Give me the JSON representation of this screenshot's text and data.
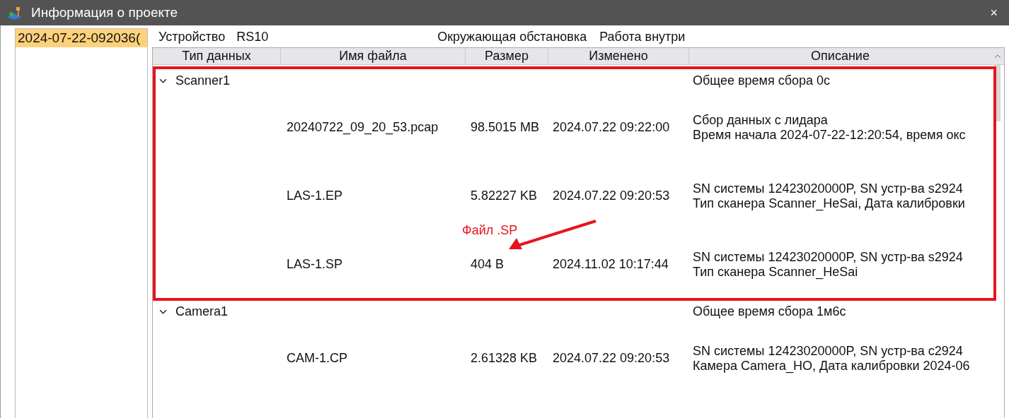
{
  "window": {
    "title": "Информация о проекте",
    "close": "×"
  },
  "projects": [
    {
      "label": "2024-07-22-092036(",
      "selected": true
    }
  ],
  "info": [
    {
      "label": "Устройство",
      "value": "RS10"
    },
    {
      "label": "Окружающая обстановка",
      "value": "Работа внутри"
    }
  ],
  "table": {
    "columns": [
      "Тип данных",
      "Имя файла",
      "Размер",
      "Изменено",
      "Описание"
    ],
    "groups": [
      {
        "name": "Scanner1",
        "expanded": true,
        "description": "Общее время сбора 0с",
        "rows": [
          {
            "file": "20240722_09_20_53.pcap",
            "size": "98.5015 MB",
            "modified": "2024.07.22 09:22:00",
            "description": [
              "Сбор данных с лидара",
              "Время начала 2024-07-22-12:20:54, время окс"
            ]
          },
          {
            "file": "LAS-1.EP",
            "size": "5.82227 KB",
            "modified": "2024.07.22 09:20:53",
            "description": [
              "SN системы  12423020000P, SN устр-ва s2924",
              "Тип сканера Scanner_HeSai, Дата калибровки"
            ]
          },
          {
            "file": "LAS-1.SP",
            "size": "404 B",
            "modified": "2024.11.02 10:17:44",
            "description": [
              "SN системы  12423020000P, SN устр-ва s2924",
              "Тип сканера Scanner_HeSai"
            ]
          }
        ]
      },
      {
        "name": "Camera1",
        "expanded": true,
        "description": "Общее время сбора 1м6с",
        "rows": [
          {
            "file": "CAM-1.CP",
            "size": "2.61328 KB",
            "modified": "2024.07.22 09:20:53",
            "description": [
              "SN системы  12423020000P, SN устр-ва c2924",
              "Камера Camera_HO, Дата калибровки 2024-06"
            ]
          }
        ]
      }
    ]
  },
  "annotation": {
    "label": "Файл .SP"
  }
}
